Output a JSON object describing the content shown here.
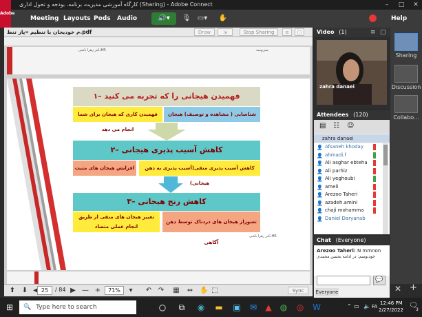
{
  "window": {
    "title": "کارگاه آموزشی مدیریت برنامه، بودجه و تحول اداری (Sharing) - Adobe Connect",
    "logo_text": "Adobe"
  },
  "menu": {
    "items": [
      "Meeting",
      "Layouts",
      "Pods",
      "Audio"
    ],
    "help": "Help"
  },
  "share": {
    "filename": "م خودیجان با تنظیم «پاز تنظ.pdf",
    "draw_label": "Draw",
    "stop_sharing_label": "Stop Sharing"
  },
  "slide": {
    "header_left": "دکتر زهرا باشیHR",
    "header_right": "سی‌و‌سه",
    "step1_title": "۱– فهمیدن هیجانی را که تجربه می کنید",
    "step1_left": "فهمیدن کاری که هیجان برای شما انجام می دهد",
    "step1_right": "شناسایی ( مشاهده و توصیف) هیجان",
    "step2_title": "۲– کاهش آسیب پذیری هیجانی",
    "step2_left": "افزایش هیجان های مثبت",
    "step2_right": "کاهش آسیب پذیری منفی(آسیب پذیری به ذهن هیجانی)",
    "step3_title": "۳– کاهش رنج هیجانی",
    "step3_left": "تغییر هیجان های منفی از طریق انجام عملی متضاد",
    "step3_right": "تسوزاز هیجان های دردناک توسط ذهن آگاهی",
    "footer": "دکتر زهرا باشیHR"
  },
  "nav": {
    "page_current": "25",
    "page_total": "/ 84",
    "zoom": "71%",
    "sync_label": "Sync"
  },
  "video": {
    "title": "Video",
    "count": "(1)",
    "participant": "zahra danaei"
  },
  "attendees": {
    "title": "Attendees",
    "count": "(120)",
    "host": "zahra danaei",
    "list": [
      "Afsaneh khoday",
      "ahmadi.f",
      "Ali asghar ebteha",
      "Ali parhiz",
      "Ali yeghoubi",
      "ameli",
      "Arezoo Taheri",
      "azadeh.amini",
      "chaji mohamma",
      "Daniel Daryanab"
    ]
  },
  "chat": {
    "title": "Chat",
    "scope": "(Everyone)",
    "sender": "Arezoo Taheri:",
    "message1": "N mmnon",
    "message2": "خودنوسم: در ادامه بحسن محمدی",
    "tab": "Everyone"
  },
  "layouts": {
    "items": [
      "Sharing",
      "Discussion",
      "Collabo..."
    ]
  },
  "taskbar": {
    "search_placeholder": "Type here to search",
    "lang": "FA",
    "time": "12:46 PM",
    "date": "2/27/2022",
    "notif": "3"
  },
  "colors": {
    "title_box": "#d9d9c4",
    "yellow_box": "#ffeb3b",
    "blue_box": "#8ecae6",
    "teal_box": "#5ec8c8",
    "orange_box": "#f4a582",
    "arrow": "#cfd8a8"
  }
}
